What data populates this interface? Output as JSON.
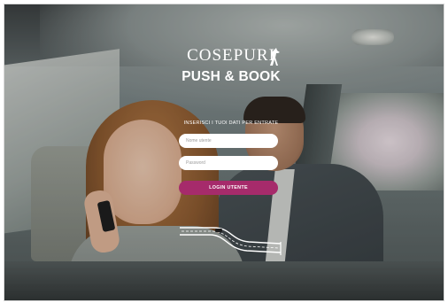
{
  "brand": {
    "name": "COSEPURI",
    "tagline": "PUSH & BOOK"
  },
  "login": {
    "title": "INSERISCI I TUOI DATI PER ENTRATE",
    "username_placeholder": "Nome utente",
    "password_placeholder": "Password",
    "button_label": "LOGIN UTENTE"
  },
  "colors": {
    "accent": "#a62b6b",
    "text_light": "#ffffff",
    "field_bg": "#ffffff"
  },
  "icons": {
    "logo": "greyhound-dog-icon",
    "road": "road-with-car-icon"
  }
}
